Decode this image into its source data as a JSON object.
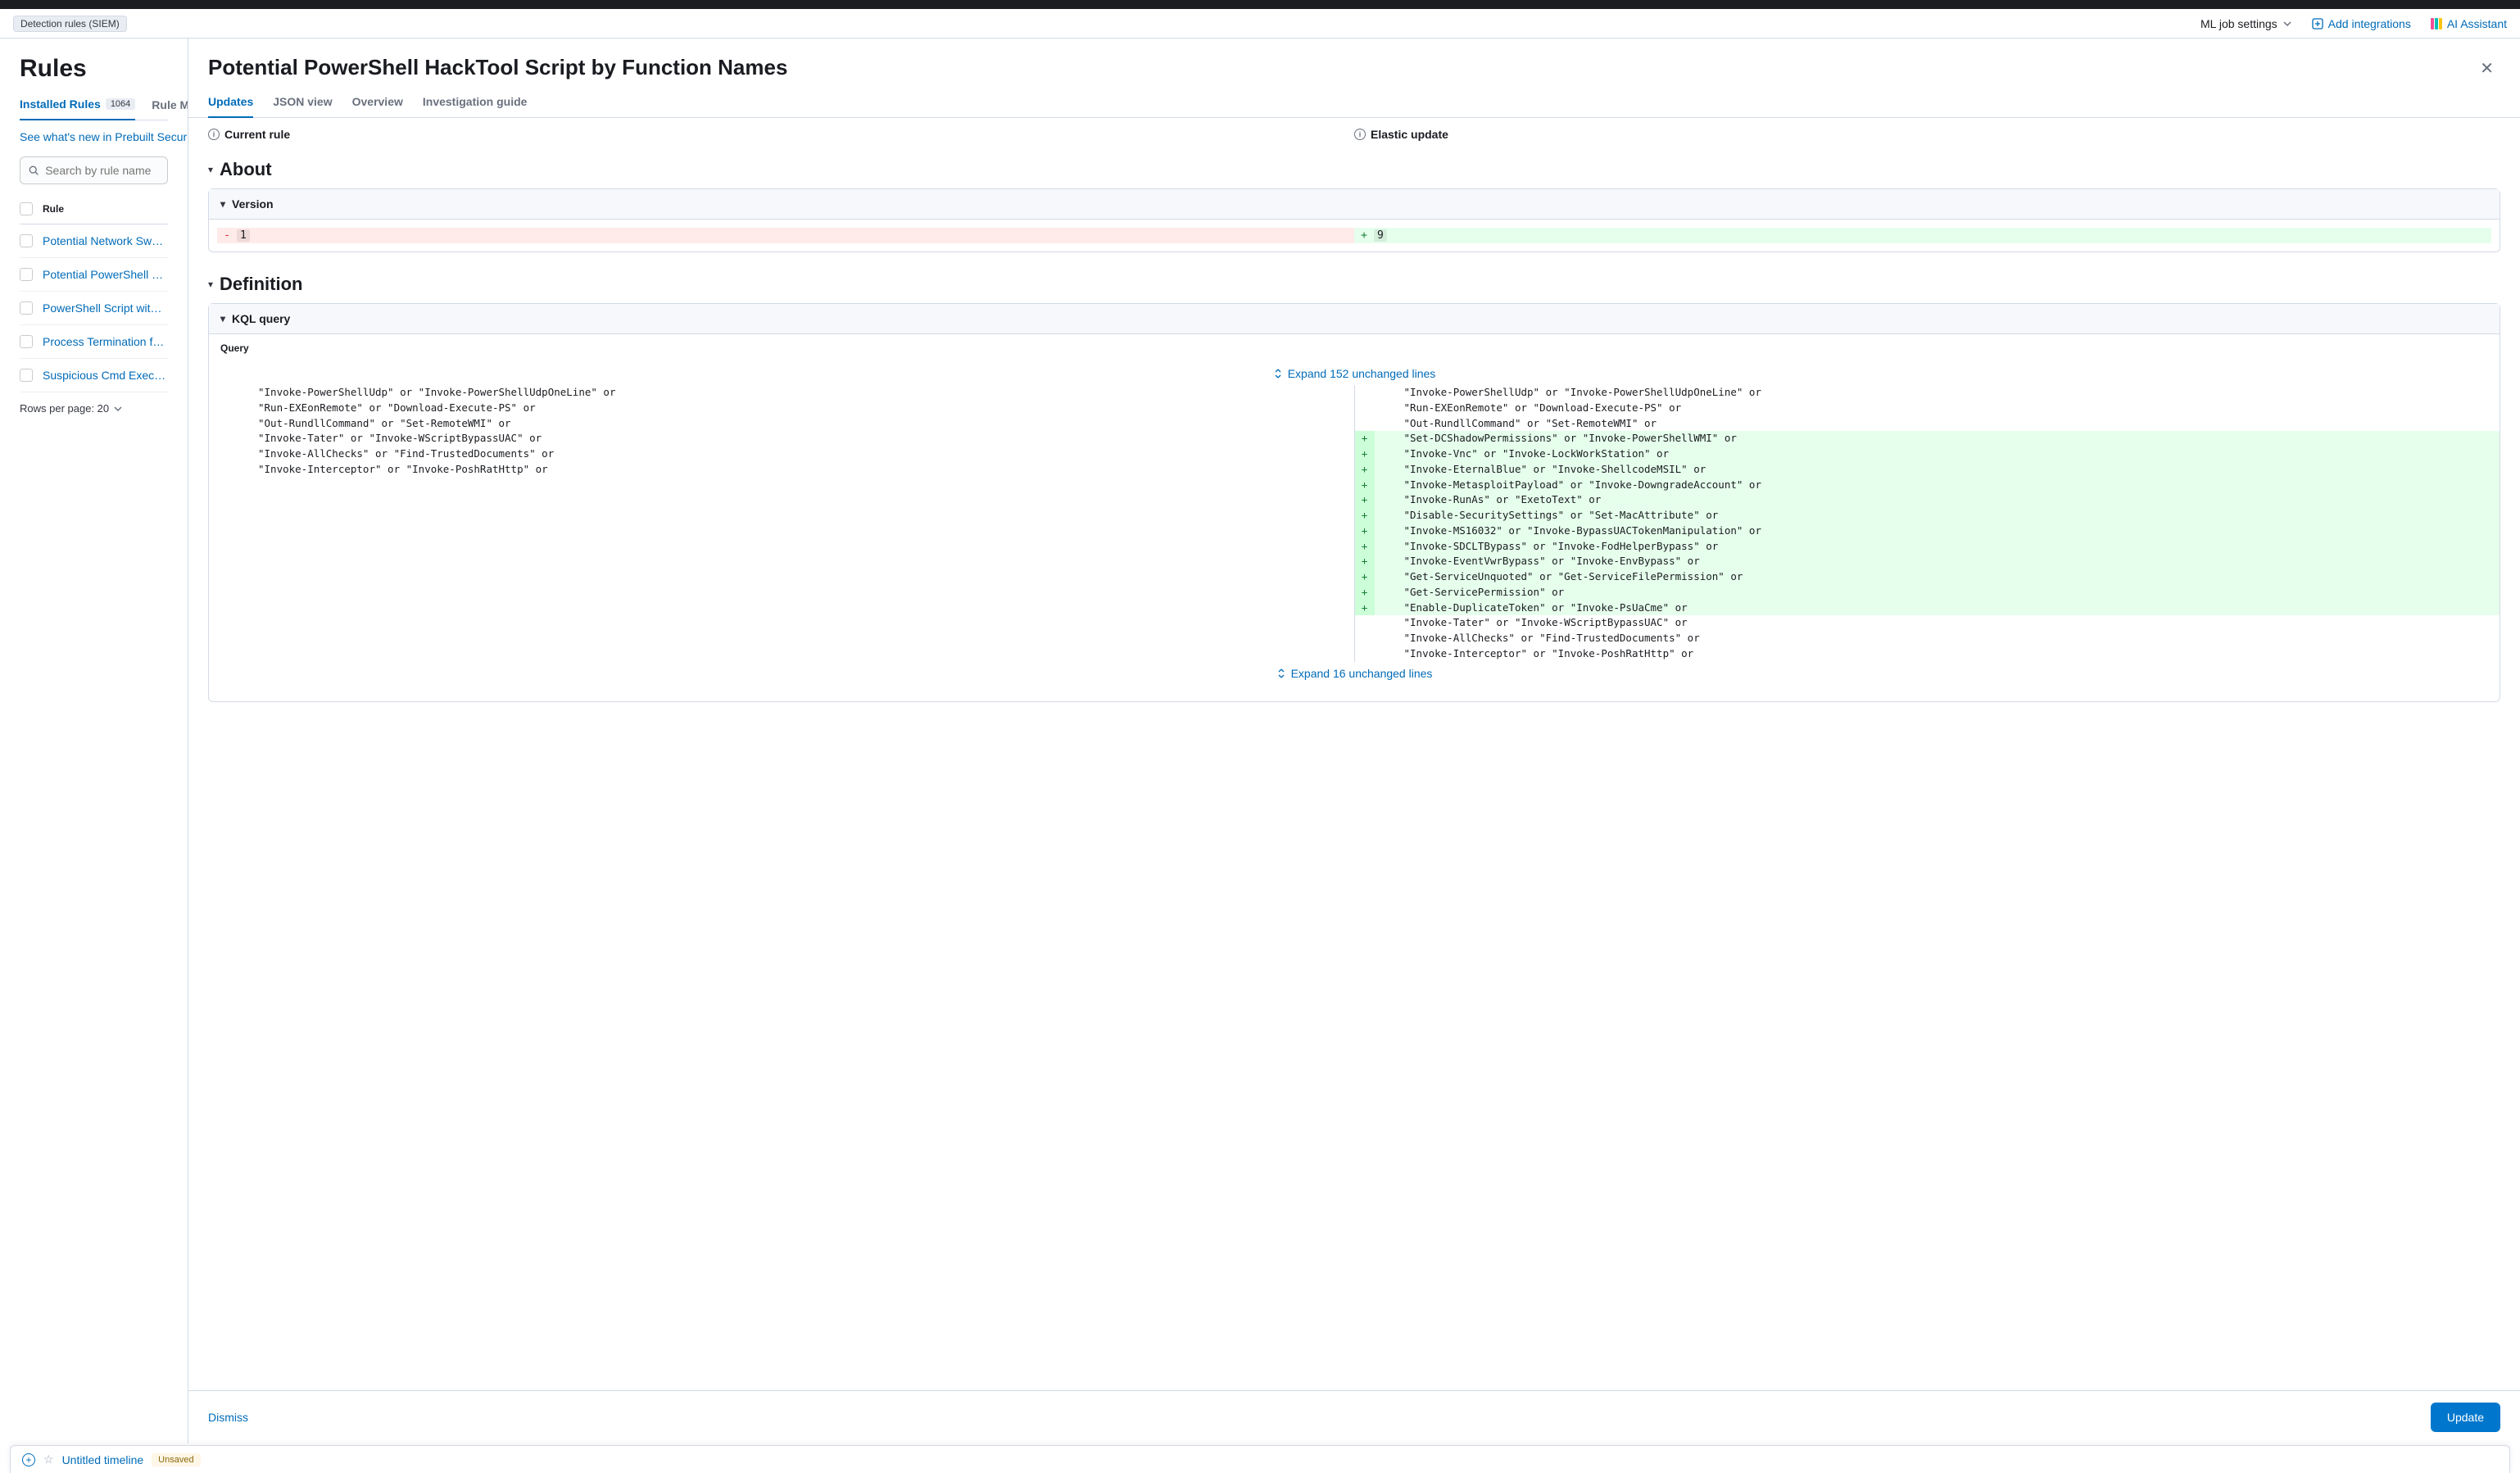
{
  "breadcrumb": "Detection rules (SIEM)",
  "header": {
    "ml_settings": "ML job settings",
    "add_integrations": "Add integrations",
    "ai_assistant": "AI Assistant"
  },
  "sidebar": {
    "title": "Rules",
    "tabs": {
      "installed": "Installed Rules",
      "installed_count": "1064",
      "monitoring": "Rule Monitoring"
    },
    "whats_new": "See what's new in Prebuilt Security Detection Rules",
    "search_placeholder": "Search by rule name",
    "table_header": "Rule",
    "rules": [
      "Potential Network Sweep Detected",
      "Potential PowerShell HackTool Script by Function Names",
      "PowerShell Script with Token Impersonation",
      "Process Termination followed by Deletion",
      "Suspicious Cmd Execution via WMI"
    ],
    "rows_per_page": "Rows per page: 20"
  },
  "flyout": {
    "title": "Potential PowerShell HackTool Script by Function Names",
    "tabs": {
      "updates": "Updates",
      "json": "JSON view",
      "overview": "Overview",
      "investigation": "Investigation guide"
    },
    "diff_headers": {
      "current": "Current rule",
      "elastic": "Elastic update"
    },
    "sections": {
      "about": "About",
      "version": "Version",
      "definition": "Definition",
      "kql": "KQL query"
    },
    "version_old": "1",
    "version_new": "9",
    "query_label": "Query",
    "expand_top": "Expand 152 unchanged lines",
    "expand_bottom": "Expand 16 unchanged lines",
    "code": {
      "left_context": [
        "\"Invoke-PowerShellUdp\" or \"Invoke-PowerShellUdpOneLine\" or",
        "\"Run-EXEonRemote\" or \"Download-Execute-PS\" or",
        "\"Out-RundllCommand\" or \"Set-RemoteWMI\" or"
      ],
      "right_context": [
        "\"Invoke-PowerShellUdp\" or \"Invoke-PowerShellUdpOneLine\" or",
        "\"Run-EXEonRemote\" or \"Download-Execute-PS\" or",
        "\"Out-RundllCommand\" or \"Set-RemoteWMI\" or"
      ],
      "added": [
        "\"Set-DCShadowPermissions\" or \"Invoke-PowerShellWMI\" or",
        "\"Invoke-Vnc\" or \"Invoke-LockWorkStation\" or",
        "\"Invoke-EternalBlue\" or \"Invoke-ShellcodeMSIL\" or",
        "\"Invoke-MetasploitPayload\" or \"Invoke-DowngradeAccount\" or",
        "\"Invoke-RunAs\" or \"ExetoText\" or",
        "\"Disable-SecuritySettings\" or \"Set-MacAttribute\" or",
        "\"Invoke-MS16032\" or \"Invoke-BypassUACTokenManipulation\" or",
        "\"Invoke-SDCLTBypass\" or \"Invoke-FodHelperBypass\" or",
        "\"Invoke-EventVwrBypass\" or \"Invoke-EnvBypass\" or",
        "\"Get-ServiceUnquoted\" or \"Get-ServiceFilePermission\" or",
        "\"Get-ServicePermission\" or",
        "\"Enable-DuplicateToken\" or \"Invoke-PsUaCme\" or"
      ],
      "left_trailing": [
        "\"Invoke-Tater\" or \"Invoke-WScriptBypassUAC\" or",
        "\"Invoke-AllChecks\" or \"Find-TrustedDocuments\" or",
        "\"Invoke-Interceptor\" or \"Invoke-PoshRatHttp\" or"
      ],
      "right_trailing": [
        "\"Invoke-Tater\" or \"Invoke-WScriptBypassUAC\" or",
        "\"Invoke-AllChecks\" or \"Find-TrustedDocuments\" or",
        "\"Invoke-Interceptor\" or \"Invoke-PoshRatHttp\" or"
      ]
    },
    "footer": {
      "dismiss": "Dismiss",
      "update": "Update"
    }
  },
  "timeline": {
    "title": "Untitled timeline",
    "unsaved": "Unsaved"
  }
}
